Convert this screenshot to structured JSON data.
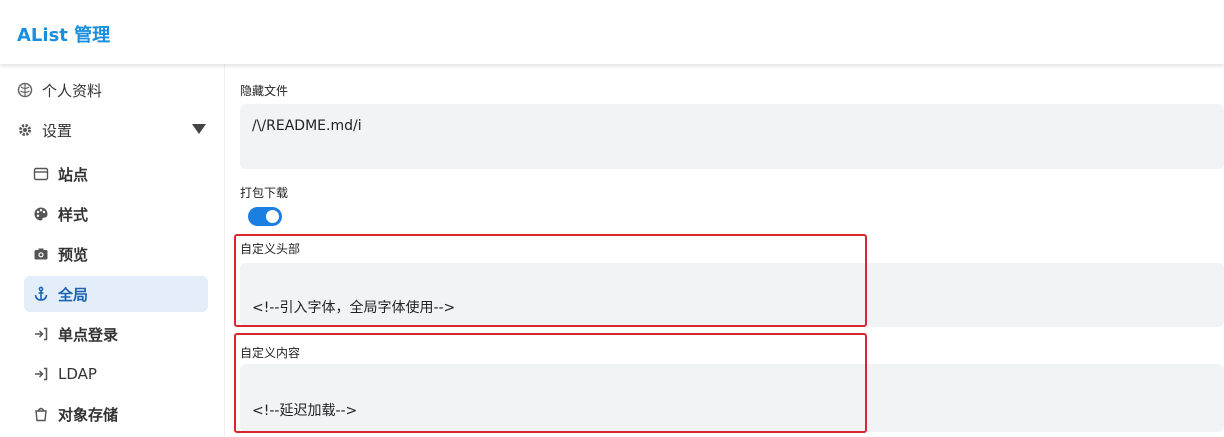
{
  "header": {
    "title": "AList 管理"
  },
  "sidebar": {
    "items": [
      {
        "label": "个人资料",
        "icon": "profile-icon"
      },
      {
        "label": "设置",
        "icon": "gear-icon"
      }
    ],
    "settings_children": [
      {
        "label": "站点",
        "icon": "window-icon"
      },
      {
        "label": "样式",
        "icon": "palette-icon"
      },
      {
        "label": "预览",
        "icon": "camera-icon"
      },
      {
        "label": "全局",
        "icon": "anchor-icon",
        "active": true
      },
      {
        "label": "单点登录",
        "icon": "login-arrow-icon"
      },
      {
        "label": "LDAP",
        "icon": "login-arrow-icon"
      },
      {
        "label": "对象存储",
        "icon": "bucket-icon"
      }
    ]
  },
  "settings": {
    "hide_files": {
      "label": "隐藏文件",
      "value": "/\\/README.md/i"
    },
    "package_download": {
      "label": "打包下载",
      "enabled": true
    },
    "custom_head": {
      "label": "自定义头部",
      "value": "<!--引入字体，全局字体使用-->"
    },
    "custom_body": {
      "label": "自定义内容",
      "value": "<!--延迟加载-->"
    }
  },
  "colors": {
    "accent": "#1a8fe0",
    "highlight_border": "#d7282f",
    "active_bg": "#e3eefa"
  }
}
